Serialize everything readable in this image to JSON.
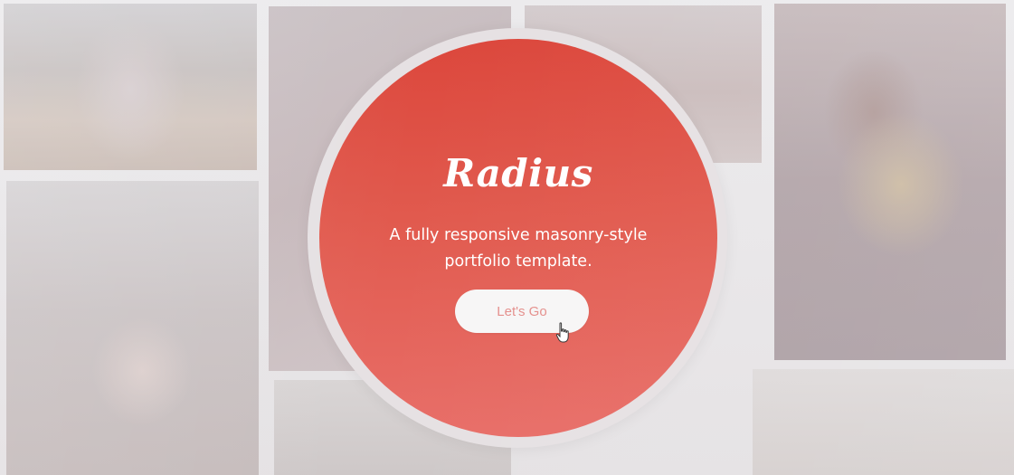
{
  "hero": {
    "brand": "Radius",
    "tagline_line1": "A fully responsive masonry-style",
    "tagline_line2": "portfolio template.",
    "cta_label": "Let's Go"
  },
  "colors": {
    "accent": "#e15a4e",
    "button_background": "#f7f6f6",
    "button_text": "#e58f8c",
    "background": "#e7e4e6"
  },
  "icons": {
    "cursor": "hand-pointer-icon"
  }
}
